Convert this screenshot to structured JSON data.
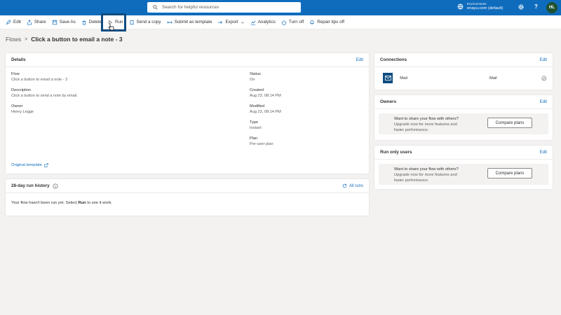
{
  "topbar": {
    "search_placeholder": "Search for helpful resources",
    "env_label": "Environments",
    "env_name": "enayu.com (default)",
    "help": "?",
    "avatar": "HL"
  },
  "commands": {
    "edit": "Edit",
    "share": "Share",
    "save_as": "Save As",
    "delete": "Delete",
    "run": "Run",
    "send_copy": "Send a copy",
    "submit_template": "Submit as template",
    "export": "Export",
    "analytics": "Analytics",
    "turn_off": "Turn off",
    "repair_tips": "Repair tips off"
  },
  "breadcrumb": {
    "root": "Flows",
    "separator": ">",
    "current": "Click a button to email a note - 3"
  },
  "details": {
    "title": "Details",
    "edit": "Edit",
    "flow_label": "Flow",
    "flow_value": "Click a button to email a note - 3",
    "description_label": "Description",
    "description_value": "Click a button to send a note by email.",
    "owner_label": "Owner",
    "owner_value": "Henry Legge",
    "status_label": "Status",
    "status_value": "On",
    "created_label": "Created",
    "created_value": "Aug 23, 08:14 PM",
    "modified_label": "Modified",
    "modified_value": "Aug 23, 08:14 PM",
    "type_label": "Type",
    "type_value": "Instant",
    "plan_label": "Plan",
    "plan_value": "Per-user plan",
    "original_template": "Original template"
  },
  "history": {
    "title": "28-day run history",
    "all_runs": "All runs",
    "message_pre": "Your flow hasn't been run yet. Select",
    "message_bold": "Run",
    "message_post": "to see it work."
  },
  "connections": {
    "title": "Connections",
    "edit": "Edit",
    "name": "Mail",
    "type": "Mail"
  },
  "owners": {
    "title": "Owners",
    "edit": "Edit",
    "promo_line1": "Want to share your flow with others?",
    "promo_line2": "Upgrade now for more features and",
    "promo_line3": "faster performance.",
    "button": "Compare plans"
  },
  "run_only_users": {
    "title": "Run only users",
    "edit": "Edit",
    "promo_line1": "Want to share your flow with others?",
    "promo_line2": "Upgrade now for more features and",
    "promo_line3": "faster performance.",
    "button": "Compare plans"
  },
  "colors": {
    "topbar": "#0f6cbd",
    "link": "#0f6cbd",
    "highlight": "#0f4c81"
  }
}
